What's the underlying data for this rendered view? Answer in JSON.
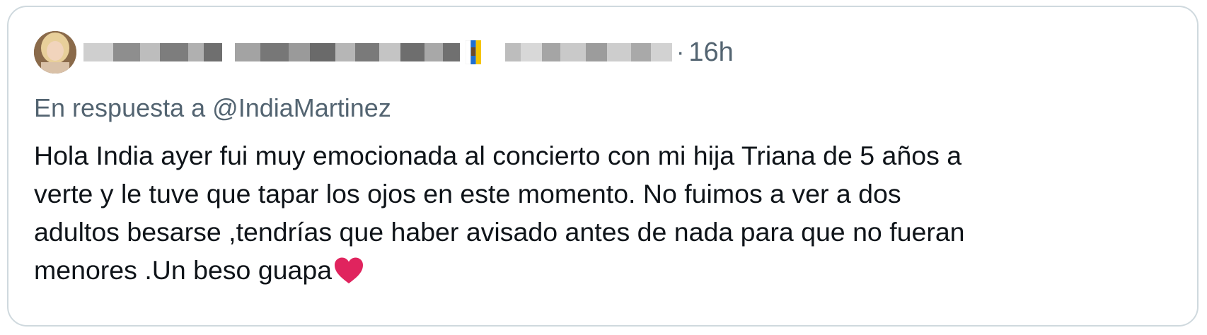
{
  "tweet": {
    "time": "16h",
    "separator": "·",
    "reply_prefix": "En respuesta a",
    "reply_handle": "@IndiaMartinez",
    "body_lines": [
      "Hola India ayer fui muy emocionada al concierto con mi hija Triana de 5 años a",
      "verte y le tuve que tapar los ojos en este momento. No fuimos a ver a dos",
      "adultos besarse ,tendrías que haber avisado antes de nada para que no fueran",
      "menores .Un beso guapa"
    ],
    "icons": {
      "avatar": "profile-photo",
      "flag": "canary-islands-flag-icon",
      "heart": "red-heart-emoji-icon"
    },
    "colors": {
      "text": "#0f1419",
      "secondary": "#536471",
      "border": "#cfd9de",
      "heart": "#e0245e"
    }
  }
}
